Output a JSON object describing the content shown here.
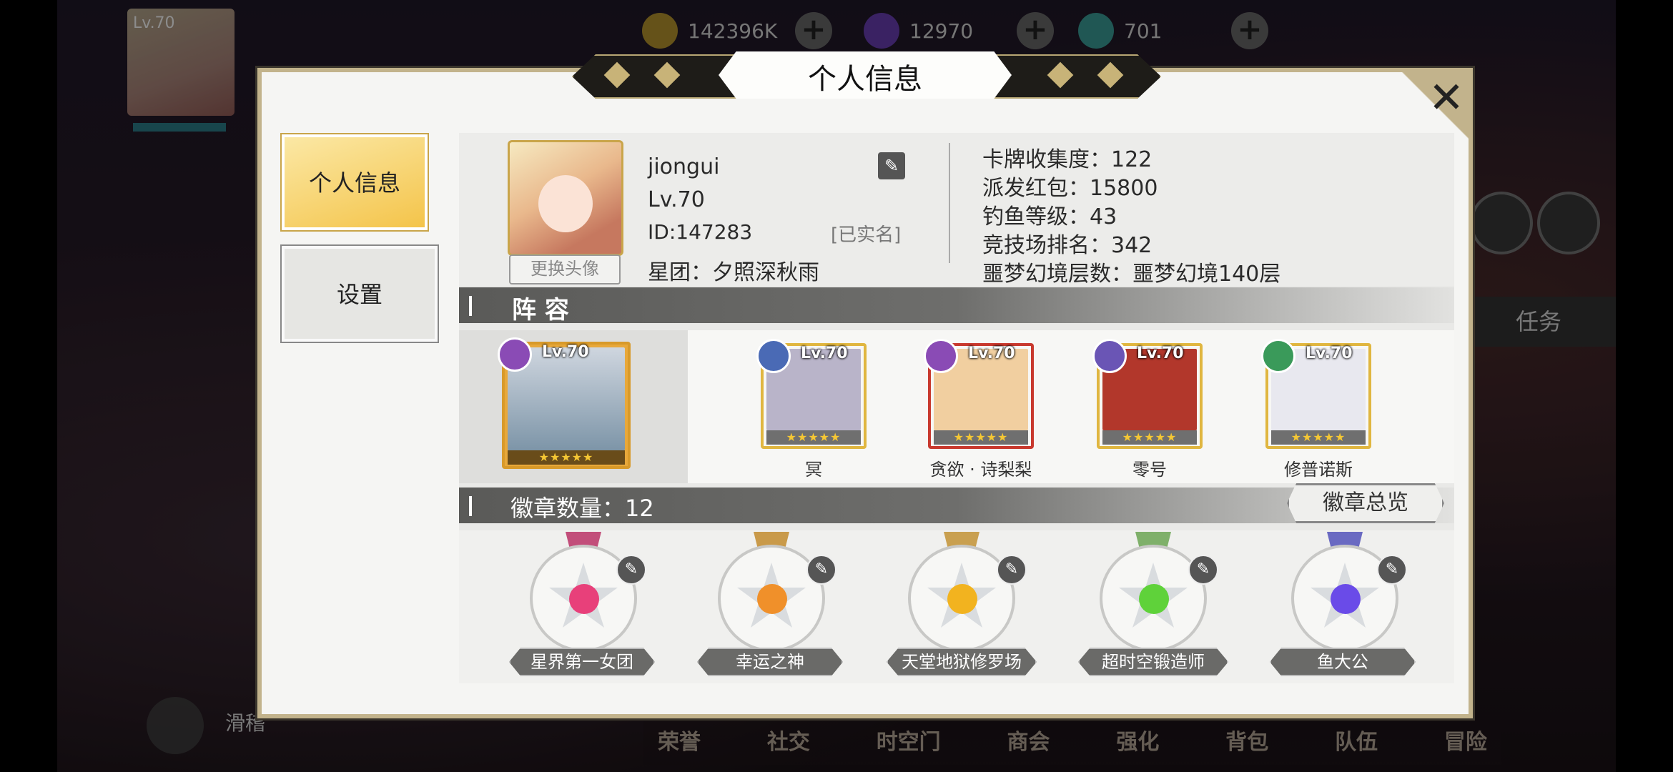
{
  "resources": [
    {
      "name": "gold-coin",
      "value": "142396K",
      "color": "#b8962e"
    },
    {
      "name": "purple-gem",
      "value": "12970",
      "color": "#6a3fb5"
    },
    {
      "name": "rainbow-crystal",
      "value": "701",
      "color": "#3b9f9a"
    }
  ],
  "hud": {
    "player_level": "Lv.70",
    "task_label": "任务",
    "chat_label": "滑稽",
    "bottom_nav": [
      "荣誉",
      "社交",
      "时空门",
      "商会",
      "强化",
      "背包",
      "队伍",
      "冒险"
    ]
  },
  "modal": {
    "title": "个人信息",
    "close_symbol": "✕",
    "tabs": [
      {
        "label": "个人信息",
        "active": true
      },
      {
        "label": "设置",
        "active": false
      }
    ]
  },
  "profile": {
    "name": "jiongui",
    "level": "Lv.70",
    "id": "ID:147283",
    "verified": "[已实名]",
    "team": "星团：夕照深秋雨",
    "change_avatar": "更换头像",
    "stats": [
      "卡牌收集度：122",
      "派发红包：15800",
      "钓鱼等级：43",
      "竞技场排名：342",
      "噩梦幻境层数：噩梦幻境140层"
    ]
  },
  "lineup": {
    "section_title": "阵 容",
    "main": {
      "level": "Lv.70",
      "stars": "★★★★★"
    },
    "members": [
      {
        "name": "冥",
        "level": "Lv.70",
        "stars": "★★★★★",
        "color": "#b9b4c9",
        "frame": "#e0b640"
      },
      {
        "name": "贪欲 · 诗梨梨",
        "level": "Lv.70",
        "stars": "★★★★★",
        "color": "#f1cfa0",
        "frame": "#c8392e"
      },
      {
        "name": "零号",
        "level": "Lv.70",
        "stars": "★★★★★",
        "color": "#b2372b",
        "frame": "#e0b640"
      },
      {
        "name": "修普诺斯",
        "level": "Lv.70",
        "stars": "★★★★★",
        "color": "#e8e8ef",
        "frame": "#e0b640"
      }
    ]
  },
  "badges": {
    "section_title": "徽章数量：12",
    "overview_button": "徽章总览",
    "items": [
      {
        "name": "星界第一女团",
        "gem_color": "#e8407a",
        "ribbon_color": "#c24e7a"
      },
      {
        "name": "幸运之神",
        "gem_color": "#f0902a",
        "ribbon_color": "#c99a4a"
      },
      {
        "name": "天堂地狱修罗场",
        "gem_color": "#f2b31f",
        "ribbon_color": "#c9a050"
      },
      {
        "name": "超时空锻造师",
        "gem_color": "#5fd23a",
        "ribbon_color": "#7fb06a"
      },
      {
        "name": "鱼大公",
        "gem_color": "#6a4be8",
        "ribbon_color": "#6a6ac2"
      }
    ]
  }
}
